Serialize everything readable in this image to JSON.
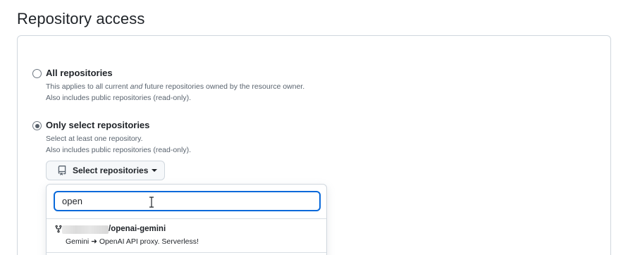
{
  "section": {
    "title": "Repository access"
  },
  "options": {
    "all": {
      "label": "All repositories",
      "desc_before": "This applies to all current ",
      "desc_em": "and",
      "desc_after": " future repositories owned by the resource owner.",
      "desc_line2": "Also includes public repositories (read-only).",
      "checked": false
    },
    "select": {
      "label": "Only select repositories",
      "desc_line1": "Select at least one repository.",
      "desc_line2": "Also includes public repositories (read-only).",
      "checked": true
    }
  },
  "select_button": {
    "label": "Select repositories",
    "icon": "repo-icon"
  },
  "search": {
    "value": "open"
  },
  "results": [
    {
      "icon": "repo-forked-icon",
      "name": "/openai-gemini",
      "description": "Gemini ➜ OpenAI API proxy. Serverless!"
    }
  ],
  "colors": {
    "accent": "#0969da",
    "border": "#d0d7de",
    "muted_text": "#59636e",
    "text": "#1f2328"
  }
}
